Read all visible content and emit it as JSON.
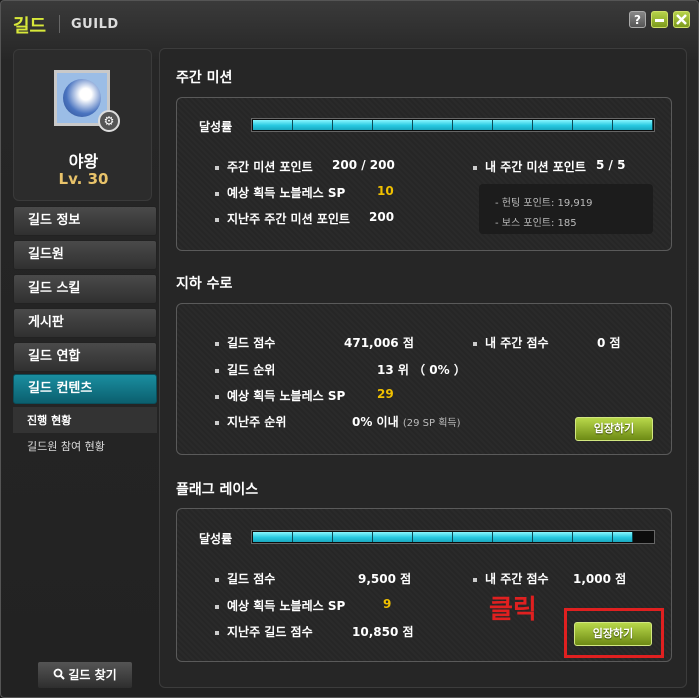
{
  "window": {
    "title_ko": "길드",
    "title_en": "GUILD",
    "help": "?"
  },
  "profile": {
    "name": "야왕",
    "level": "Lv. 30"
  },
  "menu": [
    "길드 정보",
    "길드원",
    "길드 스킬",
    "게시판",
    "길드 연합",
    "길드 컨텐츠"
  ],
  "submenu": [
    "진행 현황",
    "길드원 참여 현황"
  ],
  "find_button": "길드 찾기",
  "weekly": {
    "title": "주간 미션",
    "progress_label": "달성률",
    "progress": 1.0,
    "points_label": "주간 미션 포인트",
    "points_value": "200 / 200",
    "my_points_label": "내 주간 미션 포인트",
    "my_points_value": "5 / 5",
    "sp_label": "예상 획득 노블레스 SP",
    "sp_value": "10",
    "last_label": "지난주 주간 미션 포인트",
    "last_value": "200",
    "hunt": "- 헌팅 포인트: 19,919",
    "boss": "- 보스 포인트: 185"
  },
  "underground": {
    "title": "지하 수로",
    "score_label": "길드 점수",
    "score_value": "471,006 점",
    "my_label": "내 주간 점수",
    "my_value": "0 점",
    "rank_label": "길드 순위",
    "rank_value": "13 위 （ 0% ）",
    "sp_label": "예상 획득 노블레스 SP",
    "sp_value": "29",
    "last_label": "지난주 순위",
    "last_value": "0% 이내",
    "last_extra": "(29 SP 획득)",
    "enter": "입장하기"
  },
  "flag": {
    "title": "플래그 레이스",
    "progress_label": "달성률",
    "progress": 0.95,
    "score_label": "길드 점수",
    "score_value": "9,500 점",
    "my_label": "내 주간 점수",
    "my_value": "1,000 점",
    "sp_label": "예상 획득 노블레스 SP",
    "sp_value": "9",
    "last_label": "지난주 길드 점수",
    "last_value": "10,850 점",
    "enter": "입장하기"
  },
  "annotation": {
    "text": "클릭",
    "color": "#e02020"
  },
  "colors": {
    "accent": "#d8e83a",
    "gauge": "#27c9e0",
    "gold": "#f0c000",
    "active_tab": "#1a8ea0"
  }
}
